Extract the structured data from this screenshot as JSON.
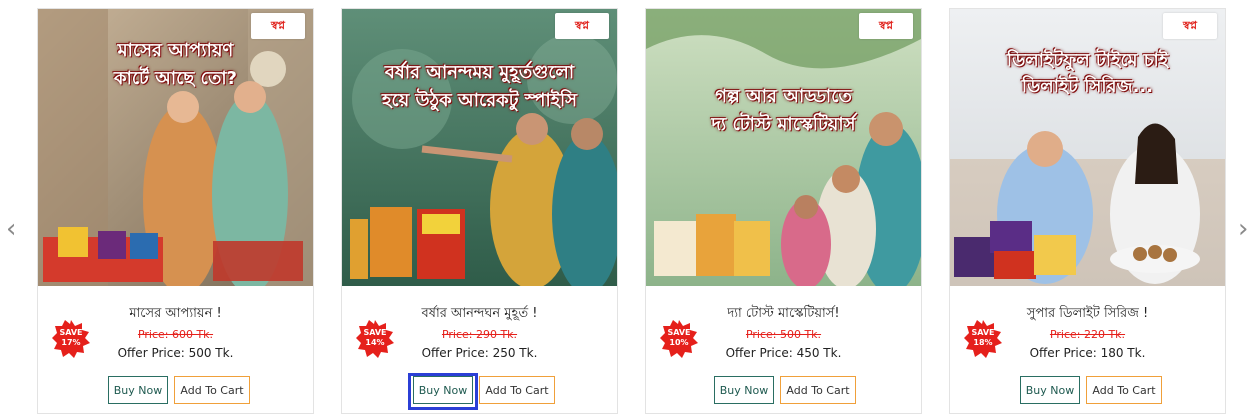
{
  "nav": {
    "prev_icon": "‹",
    "next_icon": "›"
  },
  "brand": {
    "logo_text": "স্বপ্ন"
  },
  "products": [
    {
      "headline_1": "মাসের আপ্যায়ণ",
      "headline_2": "কার্টে আছে তো?",
      "title": "মাসের আপ্যায়ন !",
      "save_label": "SAVE",
      "save_pct": "17%",
      "old_price": "Price: 600 Tk.",
      "offer_price": "Offer Price: 500 Tk.",
      "buy_label": "Buy Now",
      "cart_label": "Add To Cart"
    },
    {
      "headline_1": "বর্ষার আনন্দময় মুহূর্তগুলো",
      "headline_2": "হয়ে উঠুক আরেকটু স্পাইসি",
      "title": "বর্ষার আনন্দঘন মুহূর্ত !",
      "save_label": "SAVE",
      "save_pct": "14%",
      "old_price": "Price: 290 Tk.",
      "offer_price": "Offer Price: 250 Tk.",
      "buy_label": "Buy Now",
      "cart_label": "Add To Cart"
    },
    {
      "headline_1": "গল্প আর আড্ডাতে",
      "headline_2": "দ্য টোস্ট মাস্কেটিয়ার্স",
      "title": "দ্যা টোস্ট মাস্কেটিয়ার্স!",
      "save_label": "SAVE",
      "save_pct": "10%",
      "old_price": "Price: 500 Tk.",
      "offer_price": "Offer Price: 450 Tk.",
      "buy_label": "Buy Now",
      "cart_label": "Add To Cart"
    },
    {
      "headline_1": "ডিলাইটফুল টাইমে চাই",
      "headline_2": "ডিলাইট সিরিজ...",
      "title": "সুপার ডিলাইট সিরিজ !",
      "save_label": "SAVE",
      "save_pct": "18%",
      "old_price": "Price: 220 Tk.",
      "offer_price": "Offer Price: 180 Tk.",
      "buy_label": "Buy Now",
      "cart_label": "Add To Cart"
    }
  ],
  "colors": {
    "badge_red": "#e5201b",
    "buy_border": "#2a6e62",
    "cart_border": "#f0a03a",
    "focus_ring": "#2b3fd6"
  }
}
